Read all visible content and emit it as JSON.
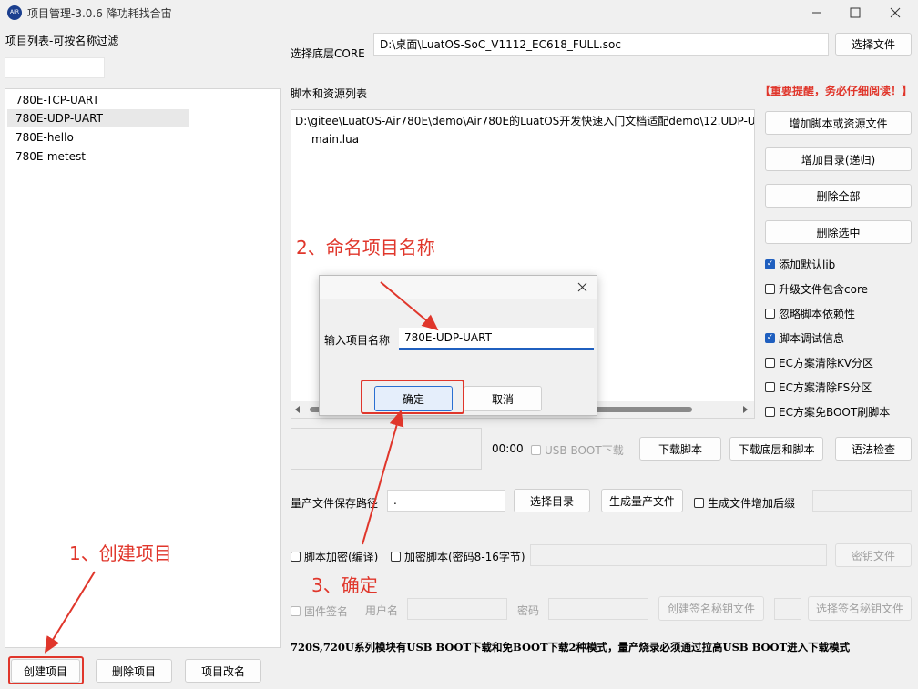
{
  "window": {
    "title": "项目管理-3.0.6 降功耗找合宙",
    "controls": [
      "minimize-icon",
      "maximize-icon",
      "close-icon"
    ]
  },
  "left": {
    "filter_label": "项目列表-可按名称过滤",
    "filter_value": "",
    "projects": [
      "780E-TCP-UART",
      "780E-UDP-UART",
      "780E-hello",
      "780E-metest"
    ],
    "selected_index": 1,
    "create_button": "创建项目",
    "delete_button": "删除项目",
    "rename_button": "项目改名"
  },
  "core": {
    "label": "选择底层CORE",
    "path": "D:\\桌面\\LuatOS-SoC_V1112_EC618_FULL.soc",
    "select_button": "选择文件"
  },
  "scripts": {
    "label": "脚本和资源列表",
    "warning": "【重要提醒，务必仔细阅读！】",
    "dir": "D:\\gitee\\LuatOS-Air780E\\demo\\Air780E的LuatOS开发快速入门文档适配demo\\12.UDP-Ua",
    "files": [
      "main.lua"
    ],
    "add_file_button": "增加脚本或资源文件",
    "add_dir_button": "增加目录(递归)",
    "delete_all_button": "删除全部",
    "delete_selected_button": "删除选中"
  },
  "options": [
    {
      "label": "添加默认lib",
      "checked": true
    },
    {
      "label": "升级文件包含core",
      "checked": false
    },
    {
      "label": "忽略脚本依赖性",
      "checked": false
    },
    {
      "label": "脚本调试信息",
      "checked": true
    },
    {
      "label": "EC方案清除KV分区",
      "checked": false
    },
    {
      "label": "EC方案清除FS分区",
      "checked": false
    },
    {
      "label": "EC方案免BOOT刷脚本",
      "checked": false
    }
  ],
  "download": {
    "time": "00:00",
    "usb_boot_label": "USB BOOT下载",
    "download_script_button": "下载脚本",
    "download_core_button": "下载底层和脚本",
    "syntax_button": "语法检查"
  },
  "production": {
    "path_label": "量产文件保存路径",
    "path_value": ".",
    "select_dir_button": "选择目录",
    "generate_button": "生成量产文件",
    "suffix_label": "生成文件增加后缀",
    "encrypt_label": "脚本加密(编译)",
    "encrypt_pwd_label": "加密脚本(密码8-16字节)",
    "key_file_button": "密钥文件",
    "firmware_sign_label": "固件签名",
    "username_label": "用户名",
    "password_label": "密码",
    "create_key_button": "创建签名秘钥文件",
    "select_key_button": "选择签名秘钥文件",
    "note": "720S,720U系列模块有USB BOOT下载和免BOOT下载2种模式，量产烧录必须通过拉高USB BOOT进入下载模式"
  },
  "dialog": {
    "label": "输入项目名称",
    "value": "780E-UDP-UART",
    "ok_button": "确定",
    "cancel_button": "取消"
  },
  "annotations": {
    "step1": "1、创建项目",
    "step2": "2、命名项目名称",
    "step3": "3、确定"
  },
  "colors": {
    "annotation_red": "#e0362b",
    "accent_blue": "#1f5fbf"
  }
}
